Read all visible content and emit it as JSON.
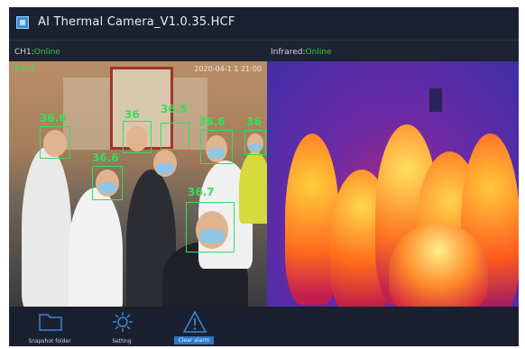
{
  "window": {
    "title": "AI Thermal Camera_V1.0.35.HCF"
  },
  "channels": {
    "ch1": {
      "label": "CH1:",
      "status": "Online"
    },
    "infrared": {
      "label": "Infrared:",
      "status": "Online"
    }
  },
  "visible_panel": {
    "corner_temp": "29.4",
    "timestamp": "2020-04-1 1 21:00",
    "detections": [
      {
        "temp": "36.6"
      },
      {
        "temp": "36"
      },
      {
        "temp": "36.5"
      },
      {
        "temp": "36.6"
      },
      {
        "temp": "36"
      },
      {
        "temp": "36.6"
      },
      {
        "temp": "36.7"
      }
    ]
  },
  "toolbar": {
    "items": [
      {
        "label": "Snapshot folder",
        "icon": "folder-icon"
      },
      {
        "label": "Setting",
        "icon": "gear-icon"
      },
      {
        "label": "Clear alarm",
        "icon": "warning-icon"
      }
    ]
  },
  "colors": {
    "online": "#2ecc40",
    "detection_box": "#34e05a",
    "alarm_button": "#2f78c7"
  }
}
